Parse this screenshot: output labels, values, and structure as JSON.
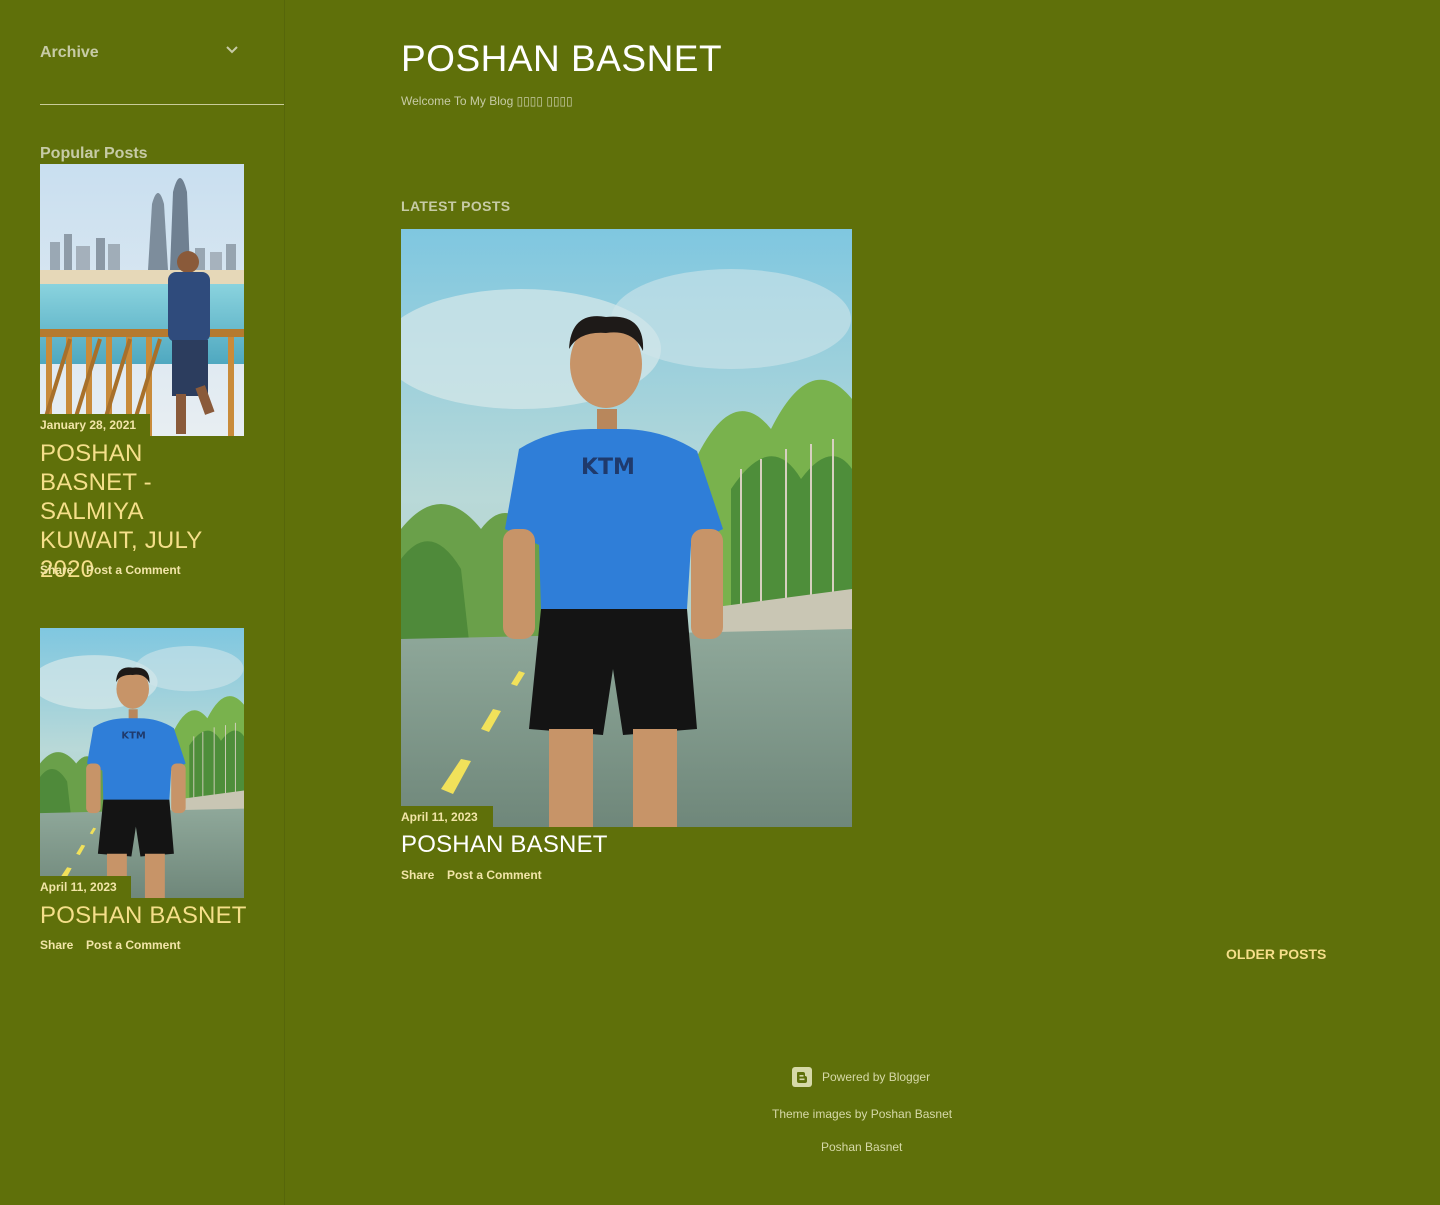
{
  "header": {
    "title": "POSHAN BASNET",
    "description": "Welcome To My Blog ▯▯▯▯ ▯▯▯▯"
  },
  "sidebar": {
    "archive_label": "Archive",
    "popular_heading": "Popular Posts",
    "posts": [
      {
        "date": "January 28, 2021",
        "title": "POSHAN BASNET - SALMIYA KUWAIT, JULY 2020",
        "share": "Share",
        "comment": "Post a Comment"
      },
      {
        "date": "April 11, 2023",
        "title": "POSHAN BASNET",
        "share": "Share",
        "comment": "Post a Comment"
      }
    ]
  },
  "main": {
    "heading": "LATEST POSTS",
    "post": {
      "date": "April 11, 2023",
      "title": "POSHAN BASNET",
      "share": "Share",
      "comment": "Post a Comment"
    },
    "older_posts": "OLDER POSTS"
  },
  "footer": {
    "powered": "Powered by Blogger",
    "theme": "Theme images by Poshan Basnet",
    "name": "Poshan Basnet"
  },
  "colors": {
    "background": "#5f700a",
    "title_accent": "#f5df8a",
    "muted_text": "#c7cba6"
  },
  "icons": {
    "archive_toggle": "chevron-down-icon",
    "blogger_logo": "blogger-icon"
  }
}
